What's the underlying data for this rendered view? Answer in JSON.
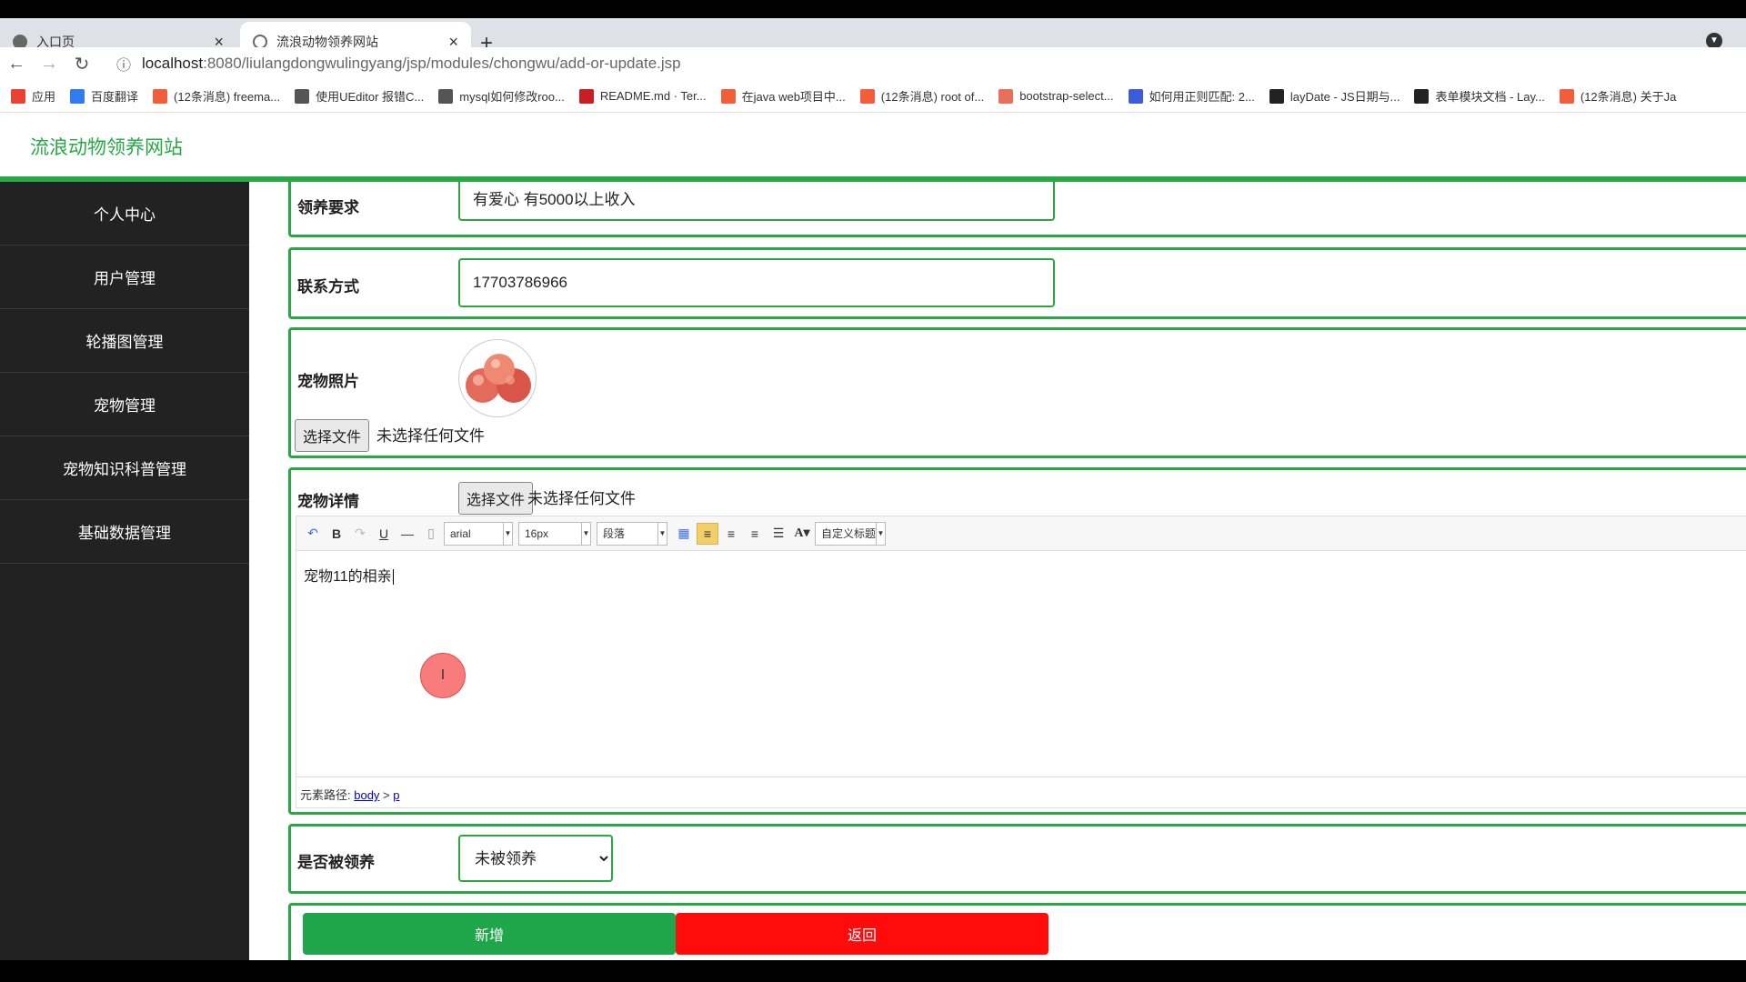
{
  "browser": {
    "tabs": [
      {
        "title": "入口页",
        "active": false
      },
      {
        "title": "流浪动物领养网站",
        "active": true
      }
    ],
    "url_host": "localhost",
    "url_path": ":8080/liulangdongwulingyang/jsp/modules/chongwu/add-or-update.jsp",
    "bookmarks": [
      {
        "icon": "apps-icon",
        "label": "应用",
        "color": "#e94235"
      },
      {
        "icon": "translate-icon",
        "label": "百度翻译",
        "color": "#2f7bf0"
      },
      {
        "icon": "csdn-icon",
        "label": "(12条消息) freema...",
        "color": "#f45d3a"
      },
      {
        "icon": "feather-icon",
        "label": "使用UEditor 报错C...",
        "color": "#555555"
      },
      {
        "icon": "feather-icon",
        "label": "mysql如何修改roo...",
        "color": "#555555"
      },
      {
        "icon": "gitee-icon",
        "label": "README.md · Ter...",
        "color": "#c71d23"
      },
      {
        "icon": "csdn-icon",
        "label": "在java web项目中...",
        "color": "#f45d3a"
      },
      {
        "icon": "csdn-icon",
        "label": "(12条消息) root of...",
        "color": "#f45d3a"
      },
      {
        "icon": "jianshu-icon",
        "label": "bootstrap-select...",
        "color": "#ea6f5a"
      },
      {
        "icon": "baidu-icon",
        "label": "如何用正则匹配: 2...",
        "color": "#3b5bdb"
      },
      {
        "icon": "layui-icon",
        "label": "layDate - JS日期与...",
        "color": "#222222"
      },
      {
        "icon": "layui-icon",
        "label": "表单模块文档 - Lay...",
        "color": "#222222"
      },
      {
        "icon": "csdn-icon",
        "label": "(12条消息) 关于Ja",
        "color": "#f45d3a"
      }
    ]
  },
  "site": {
    "title": "流浪动物领养网站"
  },
  "sidebar": {
    "items": [
      {
        "label": "个人中心"
      },
      {
        "label": "用户管理"
      },
      {
        "label": "轮播图管理"
      },
      {
        "label": "宠物管理"
      },
      {
        "label": "宠物知识科普管理"
      },
      {
        "label": "基础数据管理"
      }
    ]
  },
  "form": {
    "adopt_req": {
      "label": "领养要求",
      "value": "有爱心 有5000以上收入"
    },
    "contact": {
      "label": "联系方式",
      "value": "17703786966"
    },
    "photo": {
      "label": "宠物照片",
      "choose_btn": "选择文件",
      "no_file": "未选择任何文件"
    },
    "detail": {
      "label": "宠物详情",
      "choose_btn": "选择文件",
      "no_file": "未选择任何文件",
      "font_family": "arial",
      "font_size": "16px",
      "paragraph": "段落",
      "custom_title": "自定义标题",
      "content": "宠物11的相亲",
      "path_label": "元素路径: ",
      "path_body": "body",
      "path_sep": " > ",
      "path_p": "p"
    },
    "adopted": {
      "label": "是否被领养",
      "selected": "未被领养"
    },
    "buttons": {
      "add": "新增",
      "back": "返回"
    }
  },
  "colors": {
    "accent": "#28a745",
    "add_button": "#1fa64a",
    "back_button": "#ff0b0b",
    "sidebar": "#222222"
  }
}
